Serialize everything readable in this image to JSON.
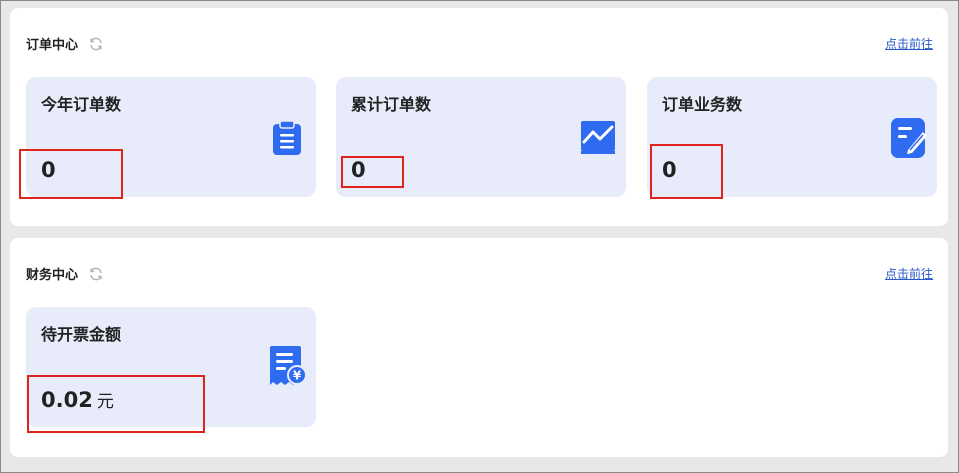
{
  "order_center": {
    "title": "订单中心",
    "refresh_icon": "refresh-icon",
    "link_label": "点击前往",
    "cards": [
      {
        "label": "今年订单数",
        "value": "0",
        "icon": "clipboard-icon"
      },
      {
        "label": "累计订单数",
        "value": "0",
        "icon": "line-chart-icon"
      },
      {
        "label": "订单业务数",
        "value": "0",
        "icon": "edit-note-icon"
      }
    ]
  },
  "finance_center": {
    "title": "财务中心",
    "refresh_icon": "refresh-icon",
    "link_label": "点击前往",
    "cards": [
      {
        "label": "待开票金额",
        "value": "0.02",
        "unit": "元",
        "icon": "invoice-yuan-icon"
      }
    ]
  },
  "colors": {
    "accent_blue": "#2f6bf0",
    "card_bg": "#e8ecfa",
    "link": "#2a59c9",
    "highlight_red": "#e0241c"
  }
}
